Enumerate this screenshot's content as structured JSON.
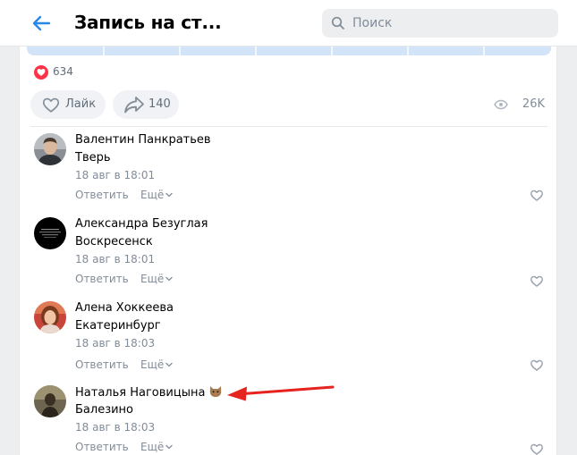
{
  "header": {
    "title": "Запись на ст...",
    "search_placeholder": "Поиск"
  },
  "post": {
    "likes_count": "634",
    "like_label": "Лайк",
    "share_count": "140",
    "views_count": "26K"
  },
  "comments": [
    {
      "name": "Валентин Панкратьев",
      "text": "Тверь",
      "date": "18 авг в 18:01",
      "reply": "Ответить",
      "more": "Ещё"
    },
    {
      "name": "Александра Безуглая",
      "text": "Воскресенск",
      "date": "18 авг в 18:01",
      "reply": "Ответить",
      "more": "Ещё"
    },
    {
      "name": "Алена Хоккеева",
      "text": "Екатеринбург",
      "date": "18 авг в 18:03",
      "reply": "Ответить",
      "more": "Ещё"
    },
    {
      "name": "Наталья Наговицына",
      "text": "Балезино",
      "date": "18 авг в 18:03",
      "reply": "Ответить",
      "more": "Ещё"
    }
  ],
  "colors": {
    "accent": "#2688eb",
    "like_red": "#ff3347",
    "annotation_arrow": "#e52420"
  },
  "icons": [
    "back-arrow-icon",
    "search-icon",
    "heart-icon",
    "share-icon",
    "eye-icon",
    "chevron-down-icon",
    "cat-emoji-icon"
  ]
}
